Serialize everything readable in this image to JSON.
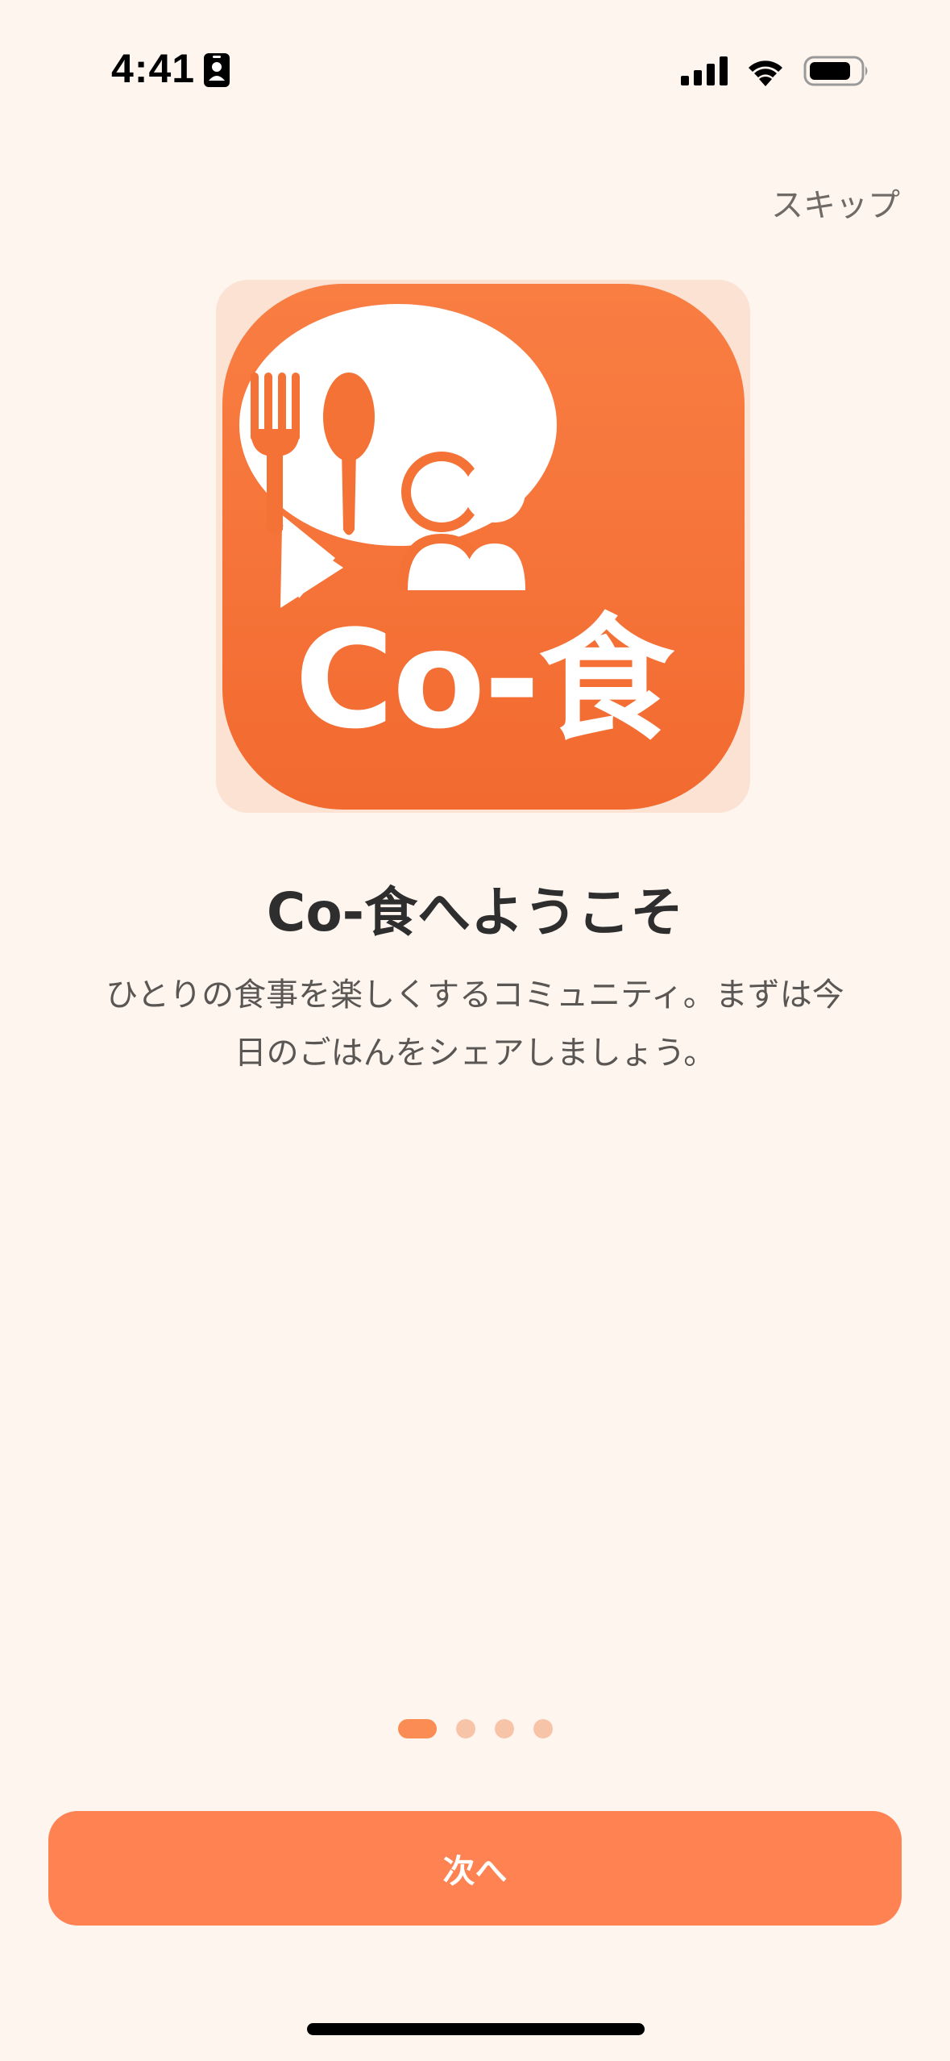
{
  "status_bar": {
    "time": "4:41",
    "icons": [
      "id-card-icon",
      "cellular-signal-icon",
      "wifi-icon",
      "battery-icon"
    ]
  },
  "skip_label": "スキップ",
  "app_icon": {
    "wordmark": "Co-食",
    "icon_names": [
      "speech-bubble-icon",
      "fork-icon",
      "spoon-icon",
      "people-icon"
    ]
  },
  "title": "Co-食へようこそ",
  "description": "ひとりの食事を楽しくするコミュニティ。まずは今日のごはんをシェアしましょう。",
  "pagination": {
    "current_page": 1,
    "total_pages": 4
  },
  "next_label": "次へ",
  "colors": {
    "background": "#FEF5EF",
    "accent": "#FF8253",
    "icon_orange": "#F47236",
    "dot_active": "#FA8C54",
    "dot_inactive": "#F8C4A7",
    "title_text": "#2E2E2E",
    "body_text": "#5A5653"
  }
}
